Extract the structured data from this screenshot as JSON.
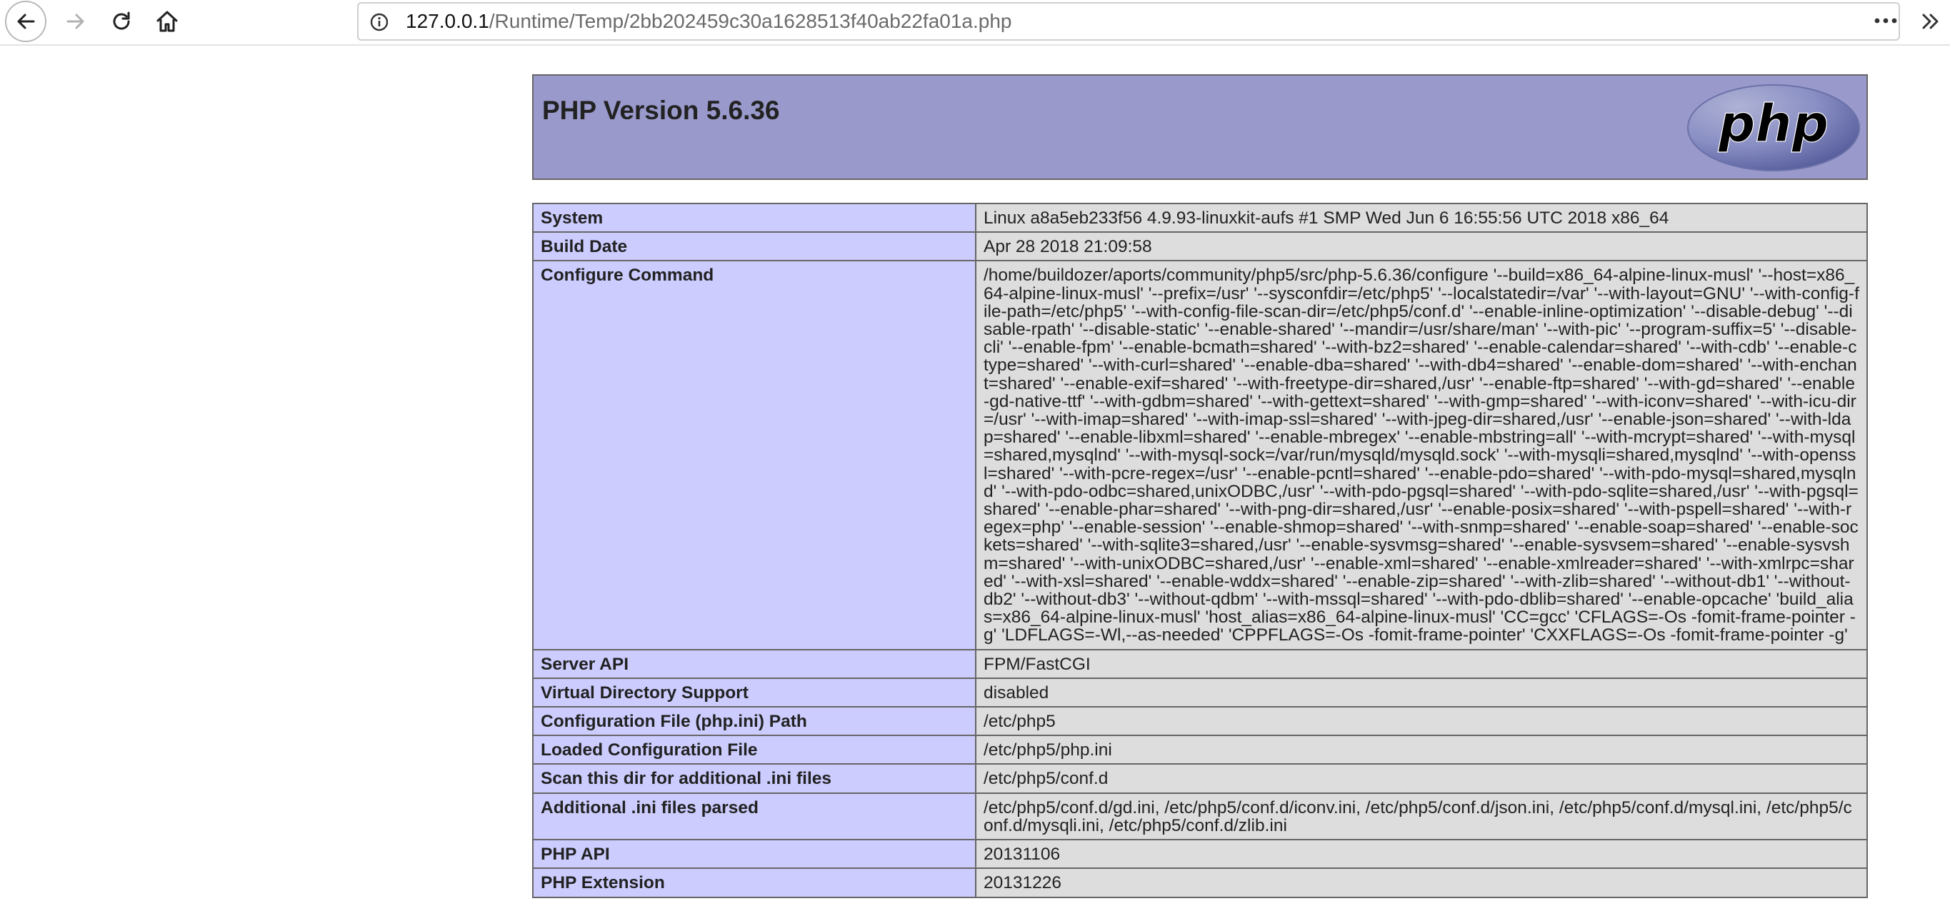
{
  "browser": {
    "url_host": "127.0.0.1",
    "url_path": "/Runtime/Temp/2bb202459c30a1628513f40ab22fa01a.php",
    "icons": [
      "back-arrow-icon",
      "forward-arrow-icon",
      "reload-icon",
      "home-icon",
      "info-icon",
      "more-dots-icon",
      "chevron-right-icon"
    ]
  },
  "page": {
    "title": "PHP Version 5.6.36",
    "logo_text": "php",
    "rows": [
      {
        "label": "System",
        "value": "Linux a8a5eb233f56 4.9.93-linuxkit-aufs #1 SMP Wed Jun 6 16:55:56 UTC 2018 x86_64"
      },
      {
        "label": "Build Date",
        "value": "Apr 28 2018 21:09:58"
      },
      {
        "label": "Configure Command",
        "value": "/home/buildozer/aports/community/php5/src/php-5.6.36/configure '--build=x86_64-alpine-linux-musl' '--host=x86_64-alpine-linux-musl' '--prefix=/usr' '--sysconfdir=/etc/php5' '--localstatedir=/var' '--with-layout=GNU' '--with-config-file-path=/etc/php5' '--with-config-file-scan-dir=/etc/php5/conf.d' '--enable-inline-optimization' '--disable-debug' '--disable-rpath' '--disable-static' '--enable-shared' '--mandir=/usr/share/man' '--with-pic' '--program-suffix=5' '--disable-cli' '--enable-fpm' '--enable-bcmath=shared' '--with-bz2=shared' '--enable-calendar=shared' '--with-cdb' '--enable-ctype=shared' '--with-curl=shared' '--enable-dba=shared' '--with-db4=shared' '--enable-dom=shared' '--with-enchant=shared' '--enable-exif=shared' '--with-freetype-dir=shared,/usr' '--enable-ftp=shared' '--with-gd=shared' '--enable-gd-native-ttf' '--with-gdbm=shared' '--with-gettext=shared' '--with-gmp=shared' '--with-iconv=shared' '--with-icu-dir=/usr' '--with-imap=shared' '--with-imap-ssl=shared' '--with-jpeg-dir=shared,/usr' '--enable-json=shared' '--with-ldap=shared' '--enable-libxml=shared' '--enable-mbregex' '--enable-mbstring=all' '--with-mcrypt=shared' '--with-mysql=shared,mysqlnd' '--with-mysql-sock=/var/run/mysqld/mysqld.sock' '--with-mysqli=shared,mysqlnd' '--with-openssl=shared' '--with-pcre-regex=/usr' '--enable-pcntl=shared' '--enable-pdo=shared' '--with-pdo-mysql=shared,mysqlnd' '--with-pdo-odbc=shared,unixODBC,/usr' '--with-pdo-pgsql=shared' '--with-pdo-sqlite=shared,/usr' '--with-pgsql=shared' '--enable-phar=shared' '--with-png-dir=shared,/usr' '--enable-posix=shared' '--with-pspell=shared' '--with-regex=php' '--enable-session' '--enable-shmop=shared' '--with-snmp=shared' '--enable-soap=shared' '--enable-sockets=shared' '--with-sqlite3=shared,/usr' '--enable-sysvmsg=shared' '--enable-sysvsem=shared' '--enable-sysvshm=shared' '--with-unixODBC=shared,/usr' '--enable-xml=shared' '--enable-xmlreader=shared' '--with-xmlrpc=shared' '--with-xsl=shared' '--enable-wddx=shared' '--enable-zip=shared' '--with-zlib=shared' '--without-db1' '--without-db2' '--without-db3' '--without-qdbm' '--with-mssql=shared' '--with-pdo-dblib=shared' '--enable-opcache' 'build_alias=x86_64-alpine-linux-musl' 'host_alias=x86_64-alpine-linux-musl' 'CC=gcc' 'CFLAGS=-Os -fomit-frame-pointer -g' 'LDFLAGS=-Wl,--as-needed' 'CPPFLAGS=-Os -fomit-frame-pointer' 'CXXFLAGS=-Os -fomit-frame-pointer -g'"
      },
      {
        "label": "Server API",
        "value": "FPM/FastCGI"
      },
      {
        "label": "Virtual Directory Support",
        "value": "disabled"
      },
      {
        "label": "Configuration File (php.ini) Path",
        "value": "/etc/php5"
      },
      {
        "label": "Loaded Configuration File",
        "value": "/etc/php5/php.ini"
      },
      {
        "label": "Scan this dir for additional .ini files",
        "value": "/etc/php5/conf.d"
      },
      {
        "label": "Additional .ini files parsed",
        "value": "/etc/php5/conf.d/gd.ini, /etc/php5/conf.d/iconv.ini, /etc/php5/conf.d/json.ini, /etc/php5/conf.d/mysql.ini, /etc/php5/conf.d/mysqli.ini, /etc/php5/conf.d/zlib.ini"
      },
      {
        "label": "PHP API",
        "value": "20131106"
      },
      {
        "label": "PHP Extension",
        "value": "20131226"
      }
    ]
  }
}
